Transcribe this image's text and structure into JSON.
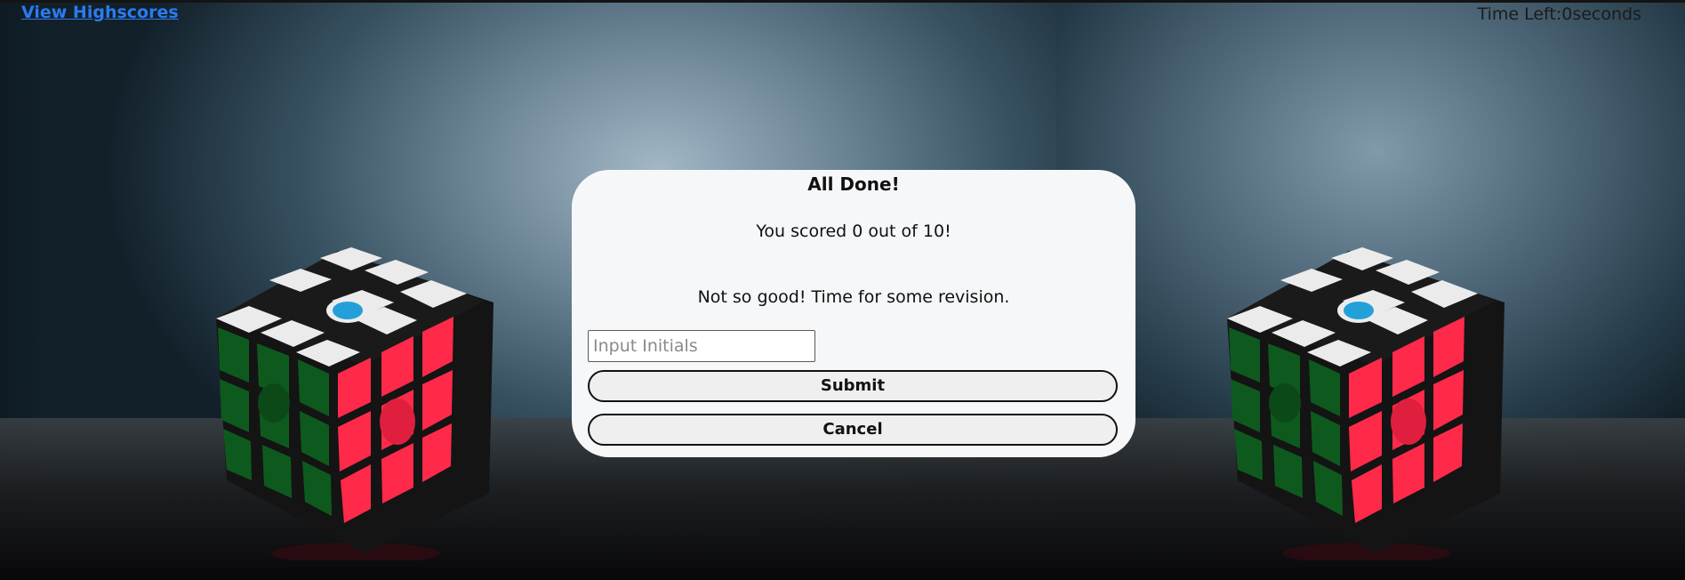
{
  "nav": {
    "highscores_link": "View Highscores",
    "timer_label": "Time Left:",
    "timer_value": "0",
    "timer_unit": "seconds"
  },
  "modal": {
    "title": "All Done!",
    "score_text": "You scored 0 out of 10!",
    "feedback": "Not so good! Time for some revision.",
    "initials_placeholder": "Input Initials",
    "initials_value": "",
    "submit_label": "Submit",
    "cancel_label": "Cancel"
  },
  "colors": {
    "link": "#2b7bf0",
    "modal_bg": "#f5f7f9",
    "button_bg": "#efefef",
    "cube_red": "#ff2a4a",
    "cube_green": "#0e5a1e",
    "cube_white": "#ebebeb",
    "cube_body": "#141414"
  },
  "background": {
    "image": "rubiks-cube-photo"
  }
}
